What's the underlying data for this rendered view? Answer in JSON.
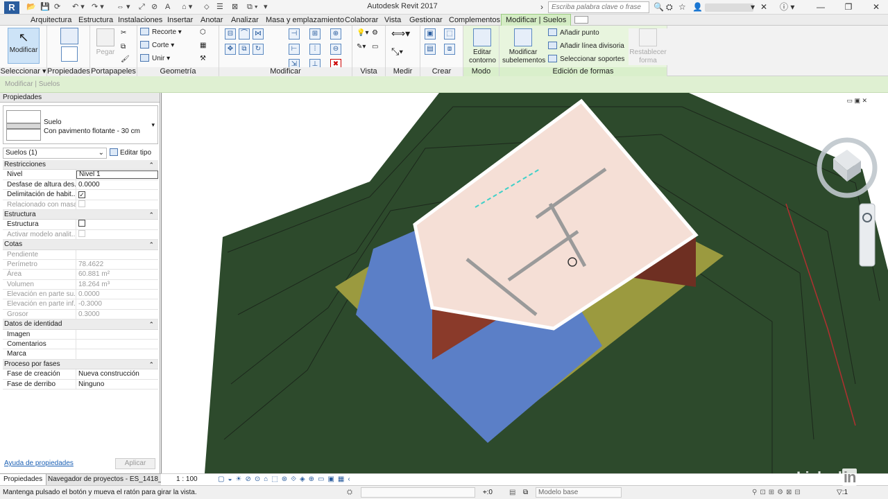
{
  "app": {
    "title": "Autodesk Revit 2017",
    "logo": "R"
  },
  "search": {
    "placeholder": "Escriba palabra clave o frase"
  },
  "tabs": [
    {
      "label": "Arquitectura"
    },
    {
      "label": "Estructura"
    },
    {
      "label": "Instalaciones"
    },
    {
      "label": "Insertar"
    },
    {
      "label": "Anotar"
    },
    {
      "label": "Analizar"
    },
    {
      "label": "Masa y emplazamiento"
    },
    {
      "label": "Colaborar"
    },
    {
      "label": "Vista"
    },
    {
      "label": "Gestionar"
    },
    {
      "label": "Complementos"
    },
    {
      "label": "Modificar | Suelos"
    }
  ],
  "ribbon": {
    "seleccionar": {
      "button": "Modificar",
      "label": "Seleccionar"
    },
    "propiedades": {
      "label": "Propiedades"
    },
    "portapapeles": {
      "paste": "Pegar",
      "label": "Portapapeles"
    },
    "geometria": {
      "recorte": "Recorte",
      "corte": "Corte",
      "unir": "Unir",
      "label": "Geometría"
    },
    "modificar": {
      "label": "Modificar"
    },
    "vista": {
      "label": "Vista"
    },
    "medir": {
      "label": "Medir"
    },
    "crear": {
      "label": "Crear"
    },
    "modo": {
      "button_line1": "Editar",
      "button_line2": "contorno",
      "label": "Modo"
    },
    "edicion": {
      "sub_line1": "Modificar",
      "sub_line2": "subelementos",
      "add_point": "Añadir punto",
      "add_split": "Añadir línea divisoria",
      "pick_supports": "Seleccionar soportes",
      "reset_line1": "Restablecer",
      "reset_line2": "forma",
      "label": "Edición de formas"
    }
  },
  "optbar": {
    "text": "Modificar | Suelos"
  },
  "properties": {
    "title": "Propiedades",
    "type_family": "Suelo",
    "type_name": "Con pavimento flotante - 30 cm",
    "instance": "Suelos (1)",
    "edit_type": "Editar tipo",
    "sections": [
      {
        "name": "Restricciones",
        "rows": [
          {
            "k": "Nivel",
            "v": "Nivel 1",
            "kind": "input"
          },
          {
            "k": "Desfase de altura des...",
            "v": "0.0000",
            "kind": "text"
          },
          {
            "k": "Delimitación de habit...",
            "v": "",
            "kind": "check-on"
          },
          {
            "k": "Relacionado con masa",
            "v": "",
            "kind": "check-dis"
          }
        ]
      },
      {
        "name": "Estructura",
        "rows": [
          {
            "k": "Estructura",
            "v": "",
            "kind": "check-off"
          },
          {
            "k": "Activar modelo analit...",
            "v": "",
            "kind": "check-dis"
          }
        ]
      },
      {
        "name": "Cotas",
        "rows": [
          {
            "k": "Pendiente",
            "v": "",
            "kind": "dis"
          },
          {
            "k": "Perímetro",
            "v": "78.4622",
            "kind": "dis"
          },
          {
            "k": "Área",
            "v": "60.881 m²",
            "kind": "dis"
          },
          {
            "k": "Volumen",
            "v": "18.264 m³",
            "kind": "dis"
          },
          {
            "k": "Elevación en parte su...",
            "v": "0.0000",
            "kind": "dis"
          },
          {
            "k": "Elevación en parte inf...",
            "v": "-0.3000",
            "kind": "dis"
          },
          {
            "k": "Grosor",
            "v": "0.3000",
            "kind": "dis"
          }
        ]
      },
      {
        "name": "Datos de identidad",
        "rows": [
          {
            "k": "Imagen",
            "v": "",
            "kind": "text"
          },
          {
            "k": "Comentarios",
            "v": "",
            "kind": "text"
          },
          {
            "k": "Marca",
            "v": "",
            "kind": "text"
          }
        ]
      },
      {
        "name": "Proceso por fases",
        "rows": [
          {
            "k": "Fase de creación",
            "v": "Nueva construcción",
            "kind": "text"
          },
          {
            "k": "Fase de derribo",
            "v": "Ninguno",
            "kind": "text"
          }
        ]
      }
    ],
    "help": "Ayuda de propiedades",
    "apply": "Aplicar"
  },
  "bottom_tabs": {
    "props": "Propiedades",
    "browser": "Navegador de proyectos - ES_1418_0..."
  },
  "viewbar": {
    "scale": "1 : 100"
  },
  "status": {
    "message": "Mantenga pulsado el botón y mueva el ratón para girar la vista.",
    "worksets": ":0",
    "model": "Modelo base",
    "filter": ":1"
  },
  "colors": {
    "terrain": "#2d4a2c",
    "floor": "#f5dfd6",
    "wall": "#8a3a2a",
    "slab": "#5b7fc7",
    "sand": "#9b9a3f",
    "ribbon_context": "#d4ecc4"
  },
  "watermark": "Linked"
}
